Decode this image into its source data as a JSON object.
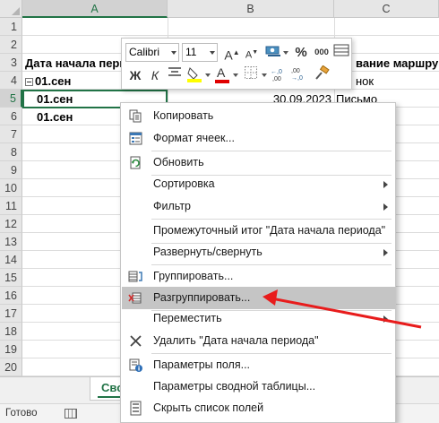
{
  "grid": {
    "columns": [
      "A",
      "B",
      "C"
    ],
    "selected_column": "A",
    "rows": [
      "1",
      "2",
      "3",
      "4",
      "5",
      "6",
      "7",
      "8",
      "9",
      "10",
      "11",
      "12",
      "13",
      "14",
      "15",
      "16",
      "17",
      "18",
      "19",
      "20"
    ],
    "selected_row": "5",
    "cells": {
      "a3": "Дата начала пери",
      "c3": "вание маршру",
      "a4": "01.сен",
      "c4": "нок",
      "a5": "01.сен",
      "b5": "30.09.2023",
      "c5": "Письмо",
      "a6": "01.сен"
    }
  },
  "mini_toolbar": {
    "font_name": "Calibri",
    "font_size": "11",
    "grow_font": "A",
    "shrink_font": "A",
    "percent": "%",
    "thousands": "000",
    "bold": "Ж",
    "italic": "К",
    "font_color_letter": "A",
    "font_color": "#e00000",
    "fill_color": "#ffff00"
  },
  "context_menu": {
    "items": [
      {
        "label": "Копировать",
        "icon": "copy-icon"
      },
      {
        "label": "Формат ячеек...",
        "icon": "format-cells-icon"
      },
      {
        "label": "Обновить",
        "icon": "refresh-icon"
      },
      {
        "label": "Сортировка",
        "icon": "",
        "submenu": true
      },
      {
        "label": "Фильтр",
        "icon": "",
        "submenu": true
      },
      {
        "label": "Промежуточный итог \"Дата начала периода\"",
        "icon": ""
      },
      {
        "label": "Развернуть/свернуть",
        "icon": "",
        "submenu": true
      },
      {
        "label": "Группировать...",
        "icon": "group-icon"
      },
      {
        "label": "Разгруппировать...",
        "icon": "ungroup-icon",
        "highlighted": true
      },
      {
        "label": "Переместить",
        "icon": "",
        "submenu": true
      },
      {
        "label": "Удалить \"Дата начала периода\"",
        "icon": "remove-icon"
      },
      {
        "label": "Параметры поля...",
        "icon": "field-settings-icon"
      },
      {
        "label": "Параметры сводной таблицы...",
        "icon": ""
      },
      {
        "label": "Скрыть список полей",
        "icon": "field-list-icon"
      }
    ]
  },
  "sheet_tab": {
    "label": "Сво"
  },
  "status": {
    "text": "Готово"
  },
  "annotation": {
    "arrow_color": "#e81c1c"
  }
}
